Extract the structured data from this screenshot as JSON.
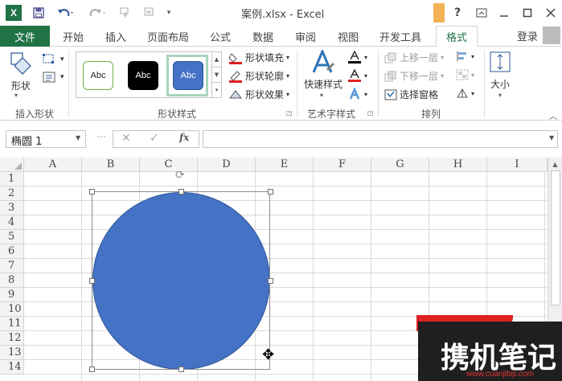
{
  "titlebar": {
    "title": "案例.xlsx - Excel",
    "app_icon": "X",
    "icons": [
      "save-icon",
      "undo-icon",
      "redo-icon",
      "touch-mode-icon",
      "customize-icon"
    ],
    "help": "?",
    "colors": {
      "brand": "#217346"
    }
  },
  "tabs": {
    "file": "文件",
    "items": [
      "开始",
      "插入",
      "页面布局",
      "公式",
      "数据",
      "审阅",
      "视图",
      "开发工具"
    ],
    "active": "格式",
    "login": "登录"
  },
  "ribbon": {
    "insert_shapes": {
      "shape_label": "形状",
      "group_label": "插入形状"
    },
    "shape_styles": {
      "swatch_text": "Abc",
      "swatch_labels": [
        "Abc",
        "Abc",
        "Abc"
      ],
      "fill": "形状填充",
      "outline": "形状轮廓",
      "effects": "形状效果",
      "group_label": "形状样式",
      "colors": {
        "selected": "#4472c4",
        "black": "#000000",
        "outline_green": "#70ad47"
      }
    },
    "wordart": {
      "quick_styles": "快速样式",
      "group_label": "艺术字样式"
    },
    "arrange": {
      "bring_forward": "上移一层",
      "send_backward": "下移一层",
      "selection_pane": "选择窗格",
      "group_label": "排列"
    },
    "size": {
      "label": "大小"
    }
  },
  "formulabar": {
    "namebox": "椭圆 1",
    "cancel": "✕",
    "enter": "✓",
    "fx": "fx",
    "value": ""
  },
  "grid": {
    "columns": [
      "A",
      "B",
      "C",
      "D",
      "E",
      "F",
      "G",
      "H",
      "I"
    ],
    "rows": [
      "1",
      "2",
      "3",
      "4",
      "5",
      "6",
      "7",
      "8",
      "9",
      "10",
      "11",
      "12",
      "13",
      "14"
    ]
  },
  "shape": {
    "type": "ellipse",
    "fill": "#4472c4"
  },
  "watermark": {
    "text": "携机笔记",
    "url": "www.cuanjibiji.com"
  }
}
